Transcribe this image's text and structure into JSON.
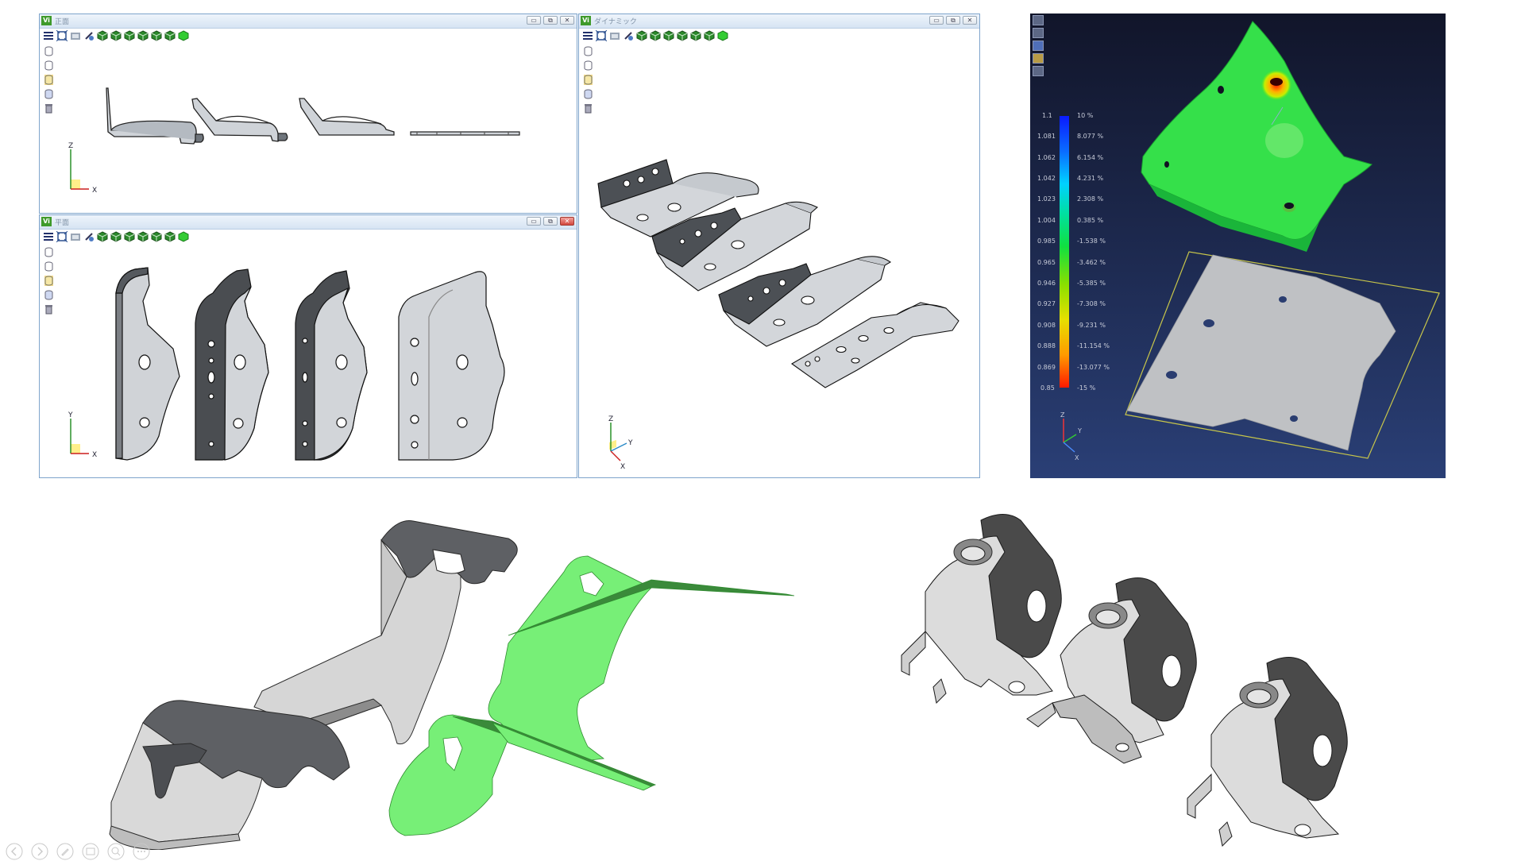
{
  "colors": {
    "accent_green": "#77ef77",
    "panel_dark_top": "#11152a",
    "panel_dark_bottom": "#2a3f76",
    "window_border": "#7ea4cc"
  },
  "windows": {
    "front": {
      "title": "正面",
      "badge": "Vi"
    },
    "plan": {
      "title": "平面",
      "badge": "Vi"
    },
    "dynamic": {
      "title": "ダイナミック",
      "badge": "Vi"
    }
  },
  "window_controls": {
    "minimize": "▭",
    "restore": "⧉",
    "close": "✕"
  },
  "axes": {
    "front": {
      "up": "Z",
      "right": "X"
    },
    "plan": {
      "up": "Y",
      "right": "X"
    },
    "dynamic": {
      "up": "Z",
      "side": "Y",
      "right": "X"
    },
    "dark": {
      "up": "Z",
      "side": "Y",
      "right": "X"
    }
  },
  "legend": {
    "left": [
      "1.1",
      "1.081",
      "1.062",
      "1.042",
      "1.023",
      "1.004",
      "0.985",
      "0.965",
      "0.946",
      "0.927",
      "0.908",
      "0.888",
      "0.869",
      "0.85"
    ],
    "right": [
      "10 %",
      "8.077 %",
      "6.154 %",
      "4.231 %",
      "2.308 %",
      "0.385 %",
      "-1.538 %",
      "-3.462 %",
      "-5.385 %",
      "-7.308 %",
      "-9.231 %",
      "-11.154 %",
      "-13.077 %",
      "-15 %"
    ]
  },
  "toolbar_icons": [
    "menu-icon",
    "fit-view-icon",
    "view-icon",
    "rotate-icon",
    "cube-icon",
    "cube-icon",
    "cube-icon",
    "cube-icon",
    "cube-icon",
    "cube-icon",
    "cube-green-icon"
  ],
  "side_icons": [
    "layer-icon",
    "layer-icon",
    "layer-active-icon",
    "layer-icon",
    "trash-icon"
  ],
  "slide_controls": [
    "prev-icon",
    "next-icon",
    "pen-icon",
    "slides-icon",
    "zoom-icon",
    "more-icon"
  ]
}
